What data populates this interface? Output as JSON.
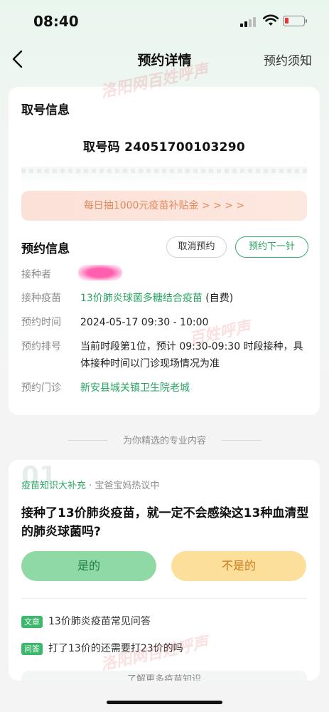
{
  "status_bar": {
    "time": "08:40"
  },
  "nav": {
    "title": "预约详情",
    "right_link": "预约须知"
  },
  "ticket": {
    "section_title": "取号信息",
    "code_label": "取号码",
    "code_value": "24051700103290",
    "promo_text": "每日抽1000元疫苗补贴金 > > > >"
  },
  "appointment": {
    "section_title": "预约信息",
    "cancel_button": "取消预约",
    "next_button": "预约下一针",
    "rows": [
      {
        "label": "接种者",
        "value": ""
      },
      {
        "label": "接种疫苗",
        "value": "13价肺炎球菌多糖结合疫苗",
        "extra": "(自费)"
      },
      {
        "label": "预约时间",
        "value": "2024-05-17 09:30 - 10:00"
      },
      {
        "label": "预约排号",
        "value": "当前时段第1位，预计 09:30-09:30 时段接种，具体接种时间以门诊现场情况为准"
      },
      {
        "label": "预约门诊",
        "value": "新安县城关镇卫生院老城"
      }
    ]
  },
  "divider_text": "为你精选的专业内容",
  "knowledge": {
    "number": "01",
    "category": "疫苗知识大补充",
    "subtitle": "· 宝爸宝妈热议中",
    "question": "接种了13价肺炎疫苗，就一定不会感染这13种血清型的肺炎球菌吗?",
    "answer_yes": "是的",
    "answer_no": "不是的",
    "links": [
      {
        "tag": "文章",
        "text": "13价肺炎疫苗常见问答"
      },
      {
        "tag": "问答",
        "text": "打了13价的还需要打23价的吗"
      }
    ],
    "more_text": "了解更多疫苗知识"
  },
  "watermark": {
    "text1": "洛阳网",
    "text2": "百姓呼声"
  },
  "colors": {
    "accent_green": "#2aa663",
    "promo_orange": "#e2895d",
    "tag_green": "#3ab86b"
  }
}
